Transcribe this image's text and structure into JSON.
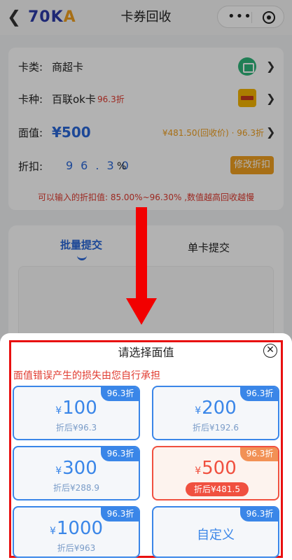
{
  "header": {
    "back_icon": "chevron-left-icon",
    "logo_part1": "70K",
    "logo_part2": "A",
    "title": "卡券回收",
    "more_icon": "more-dots-icon",
    "close_icon": "target-circle-icon"
  },
  "form": {
    "type_label": "卡类:",
    "type_value": "商超卡",
    "type_icon": "store-icon",
    "kind_label": "卡种:",
    "kind_value": "百联ok卡",
    "kind_discount": "96.3折",
    "kind_icon": "ok-card-icon",
    "face_label": "面值:",
    "face_value": "¥500",
    "face_receive": "¥481.50(回收价) · 96.3折",
    "rate_label": "折扣:",
    "rate_digits": "96.30",
    "rate_unit": "%",
    "modify_button": "修改折扣",
    "hint": "可以输入的折扣值: 85.00%~96.30% ,数值越高回收越慢"
  },
  "tabs": {
    "batch": "批量提交",
    "single": "单卡提交"
  },
  "sheet": {
    "title": "请选择面值",
    "warning": "面值错误产生的损失由您自行承担",
    "options": [
      {
        "currency": "¥",
        "amount": "100",
        "badge": "96.3折",
        "after": "折后¥96.3",
        "selected": false
      },
      {
        "currency": "¥",
        "amount": "200",
        "badge": "96.3折",
        "after": "折后¥192.6",
        "selected": false
      },
      {
        "currency": "¥",
        "amount": "300",
        "badge": "96.3折",
        "after": "折后¥288.9",
        "selected": false
      },
      {
        "currency": "¥",
        "amount": "500",
        "badge": "96.3折",
        "after": "折后¥481.5",
        "selected": true
      },
      {
        "currency": "¥",
        "amount": "1000",
        "badge": "96.3折",
        "after": "折后¥963",
        "selected": false
      },
      {
        "custom": "自定义",
        "badge": "96.3折",
        "selected": false
      }
    ]
  },
  "colors": {
    "accent_blue": "#3a86e8",
    "accent_orange": "#f0a020",
    "annotation_red": "#f20000",
    "selected_red": "#f0503f"
  }
}
